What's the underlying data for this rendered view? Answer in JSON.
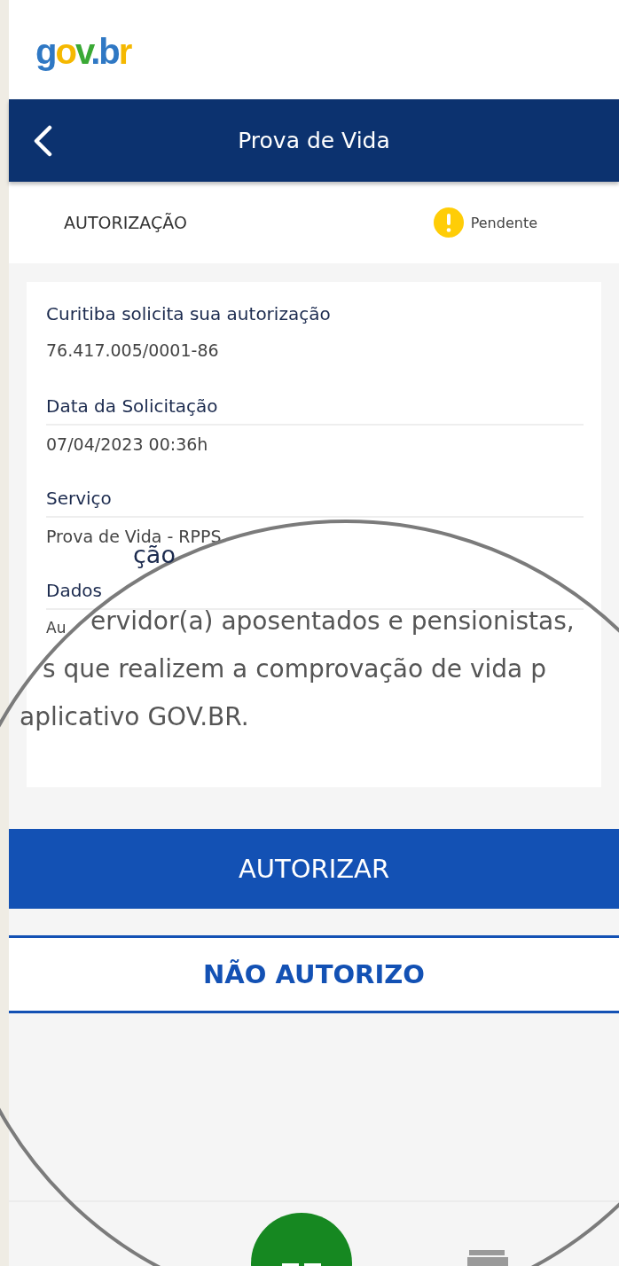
{
  "logo": {
    "text": "gov.br"
  },
  "header": {
    "title": "Prova de Vida"
  },
  "status_row": {
    "label": "AUTORIZAÇÃO",
    "status": {
      "text": "Pendente",
      "kind": "pending"
    }
  },
  "card": {
    "fields": [
      {
        "label": "Curitiba solicita sua autorização",
        "value": "76.417.005/0001-86",
        "underlined": false
      },
      {
        "label": "Data da Solicitação",
        "value": "07/04/2023 00:36h",
        "underlined": true
      },
      {
        "label": "Serviço",
        "value": "Prova de Vida - RPPS",
        "underlined": true
      },
      {
        "label": "Dados",
        "underlined": true
      }
    ],
    "small_text": "Au"
  },
  "magnifier": {
    "lines": [
      "ção",
      "ervidor(a) aposentados e pensionistas,",
      "s que realizem a comprovação de vida p",
      "aplicativo GOV.BR."
    ]
  },
  "buttons": [
    {
      "label": "AUTORIZAR",
      "kind": "primary"
    },
    {
      "label": "NÃO AUTORIZO",
      "kind": "secondary"
    }
  ],
  "bottom_nav": [
    {
      "kind": "home",
      "selected": true
    },
    {
      "kind": "wallet",
      "selected": false
    }
  ]
}
